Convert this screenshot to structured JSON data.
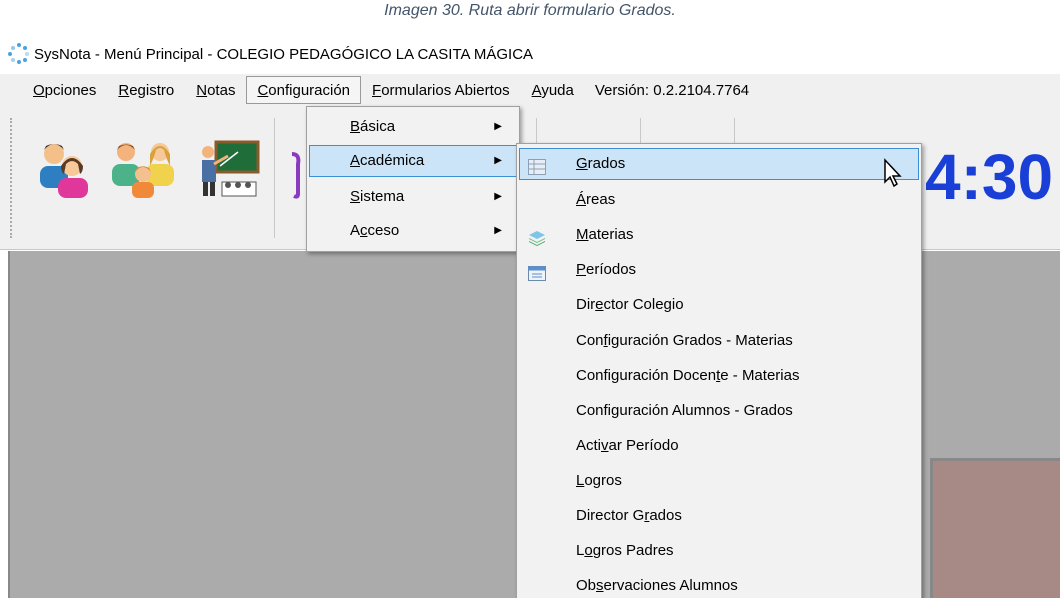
{
  "caption": "Imagen 30. Ruta abrir formulario Grados.",
  "window": {
    "title": "SysNota - Menú Principal - COLEGIO PEDAGÓGICO LA CASITA MÁGICA"
  },
  "menubar": {
    "items": [
      {
        "pre": "",
        "u": "O",
        "post": "pciones"
      },
      {
        "pre": "",
        "u": "R",
        "post": "egistro"
      },
      {
        "pre": "",
        "u": "N",
        "post": "otas"
      },
      {
        "pre": "",
        "u": "C",
        "post": "onfiguración"
      },
      {
        "pre": "",
        "u": "F",
        "post": "ormularios Abiertos"
      },
      {
        "pre": "",
        "u": "A",
        "post": "yuda"
      }
    ],
    "version": "Versión: 0.2.2104.7764"
  },
  "clock": "4:30",
  "config_menu": {
    "items": [
      {
        "pre": "",
        "u": "B",
        "post": "ásica"
      },
      {
        "pre": "",
        "u": "A",
        "post": "cadémica"
      },
      {
        "pre": "",
        "u": "S",
        "post": "istema"
      },
      {
        "pre": "A",
        "u": "c",
        "post": "ceso"
      }
    ]
  },
  "academica_menu": {
    "items": [
      {
        "pre": "",
        "u": "G",
        "post": "rados",
        "icon": "grid-icon"
      },
      {
        "pre": "",
        "u": "Á",
        "post": "reas",
        "icon": ""
      },
      {
        "pre": "",
        "u": "M",
        "post": "aterias",
        "icon": "layers-icon"
      },
      {
        "pre": "",
        "u": "P",
        "post": "eríodos",
        "icon": "calendar-icon"
      },
      {
        "pre": "Dir",
        "u": "e",
        "post": "ctor Colegio",
        "icon": ""
      },
      {
        "pre": "Con",
        "u": "f",
        "post": "iguración Grados - Materias",
        "icon": ""
      },
      {
        "pre": "Configuración Docen",
        "u": "t",
        "post": "e - Materias",
        "icon": ""
      },
      {
        "pre": "Confi",
        "u": "g",
        "post": "uración Alumnos - Grados",
        "icon": ""
      },
      {
        "pre": "Acti",
        "u": "v",
        "post": "ar Período",
        "icon": ""
      },
      {
        "pre": "",
        "u": "L",
        "post": "ogros",
        "icon": ""
      },
      {
        "pre": "Director G",
        "u": "r",
        "post": "ados",
        "icon": ""
      },
      {
        "pre": "L",
        "u": "o",
        "post": "gros Padres",
        "icon": ""
      },
      {
        "pre": "Ob",
        "u": "s",
        "post": "ervaciones Alumnos",
        "icon": ""
      }
    ]
  }
}
